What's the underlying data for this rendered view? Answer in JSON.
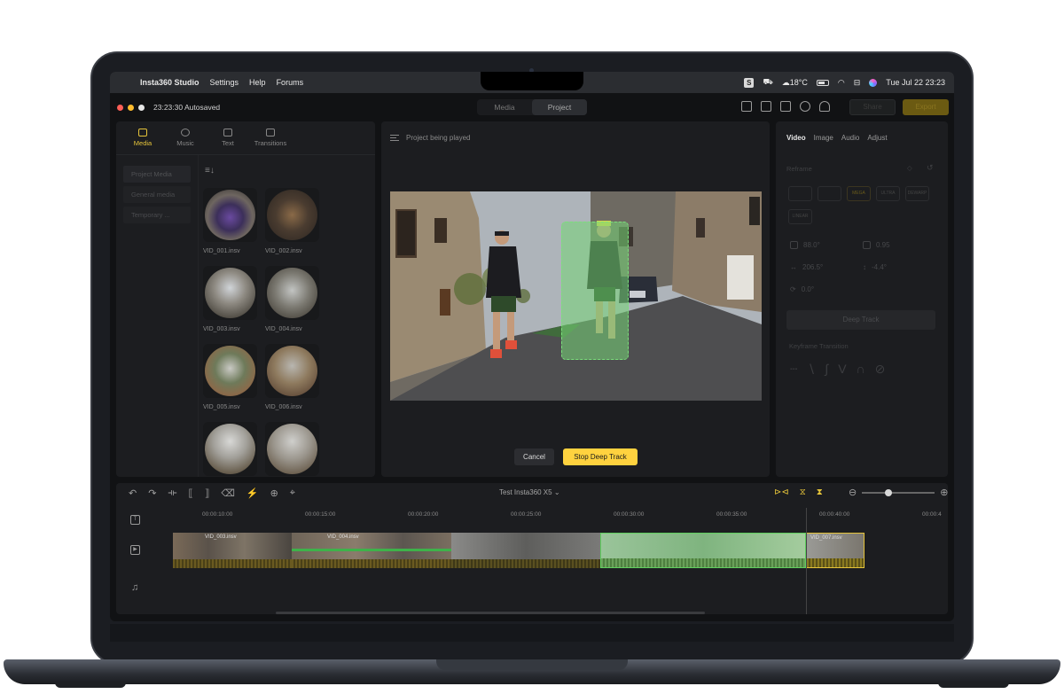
{
  "menubar": {
    "app_name": "Insta360 Studio",
    "items": [
      "Settings",
      "Help",
      "Forums"
    ],
    "status_badge": "S",
    "weather": "18°C",
    "datetime": "Tue Jul 22  23:23"
  },
  "titlebar": {
    "autosave": "23:23:30 Autosaved",
    "segments": [
      "Media",
      "Project"
    ],
    "active_segment": "Project",
    "share_label": "Share",
    "export_label": "Export"
  },
  "left_panel": {
    "tabs": [
      {
        "label": "Media",
        "icon": "folder-icon",
        "active": true
      },
      {
        "label": "Music",
        "icon": "music-note-icon",
        "active": false
      },
      {
        "label": "Text",
        "icon": "text-icon",
        "active": false
      },
      {
        "label": "Transitions",
        "icon": "transition-icon",
        "active": false
      }
    ],
    "sidebar": [
      "Project Media",
      "General media",
      "Temporary ..."
    ],
    "files": [
      "VID_001.insv",
      "VID_002.insv",
      "VID_003.insv",
      "VID_004.insv",
      "VID_005.insv",
      "VID_006.insv",
      "",
      ""
    ]
  },
  "center_panel": {
    "header": "Project being played",
    "cancel_label": "Cancel",
    "stop_label": "Stop Deep Track"
  },
  "right_panel": {
    "tabs": [
      "Video",
      "Image",
      "Audio",
      "Adjust"
    ],
    "active_tab": "Video",
    "reframe_label": "Reframe",
    "chips": [
      "",
      "",
      "MEGA",
      "ULTRA",
      "DEWARP",
      "LINEAR"
    ],
    "params": {
      "fov": "88.0°",
      "distortion": "0.95",
      "pan": "206.5°",
      "tilt": "-4.4°",
      "roll": "0.0°"
    },
    "deep_track_label": "Deep Track",
    "keyframe_label": "Keyframe Transition"
  },
  "timeline": {
    "title": "Test Insta360 X5 ⌄",
    "ticks": [
      "00:00:10:00",
      "00:00:15:00",
      "00:00:20:00",
      "00:00:25:00",
      "00:00:30:00",
      "00:00:35:00",
      "00:00:40:00",
      "00:00:4"
    ],
    "clip_labels": [
      "VID_003.insv",
      "VID_004.insv",
      "VID_007.insv"
    ]
  },
  "colors": {
    "accent": "#ffd23f",
    "track_green": "#76d676",
    "panel_bg": "#1c1d20"
  }
}
